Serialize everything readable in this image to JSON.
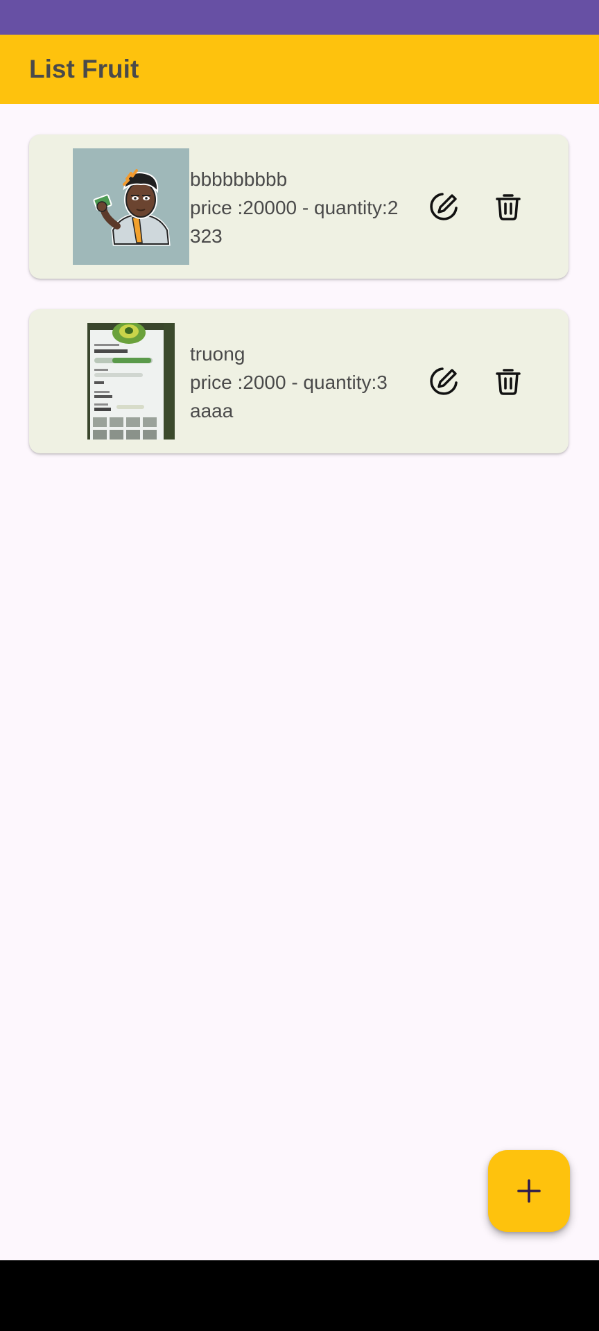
{
  "colors": {
    "status_bar": "#6750a4",
    "app_bar": "#fec20d",
    "background": "#fdf7fd",
    "card": "#eff1e3",
    "fab": "#fec20d",
    "fab_icon": "#2b1a4e",
    "nav_bar": "#000000"
  },
  "app_bar": {
    "title": "List Fruit"
  },
  "fruits": [
    {
      "name": "bbbbbbbbb",
      "price_quantity": "price :20000 - quantity:2",
      "extra": "323",
      "image": "cartoon-character-avatar",
      "edit_icon": "edit-icon",
      "delete_icon": "trash-icon"
    },
    {
      "name": "truong",
      "price_quantity": "price :2000 - quantity:3",
      "extra": "aaaa",
      "image": "game-screenshot-photo",
      "edit_icon": "edit-icon",
      "delete_icon": "trash-icon"
    }
  ],
  "fab": {
    "icon": "plus-icon"
  }
}
